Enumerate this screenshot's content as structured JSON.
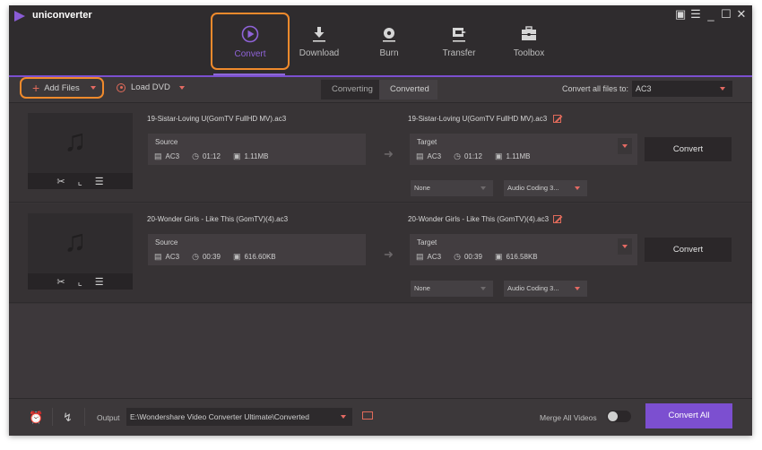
{
  "app": {
    "title": "uniconverter",
    "window_controls": [
      "feedback-icon",
      "menu-icon",
      "minimize-icon",
      "maximize-icon",
      "close-icon"
    ]
  },
  "nav": {
    "items": [
      {
        "label": "Convert",
        "icon": "convert-icon",
        "active": true
      },
      {
        "label": "Download",
        "icon": "download-icon",
        "active": false
      },
      {
        "label": "Burn",
        "icon": "burn-icon",
        "active": false
      },
      {
        "label": "Transfer",
        "icon": "transfer-icon",
        "active": false
      },
      {
        "label": "Toolbox",
        "icon": "toolbox-icon",
        "active": false
      }
    ]
  },
  "toolbar": {
    "add_files": "Add Files",
    "load_dvd": "Load DVD",
    "tabs": [
      "Converting",
      "Converted"
    ],
    "active_tab": "Converting",
    "convert_all_label": "Convert all files to:",
    "convert_all_value": "AC3"
  },
  "files": [
    {
      "source_name": "19-Sistar-Loving U(GomTV FullHD MV).ac3",
      "source_label": "Source",
      "source": {
        "format": "AC3",
        "duration": "01:12",
        "size": "1.11MB"
      },
      "target_name": "19-Sistar-Loving U(GomTV FullHD MV).ac3",
      "target_label": "Target",
      "target": {
        "format": "AC3",
        "duration": "01:12",
        "size": "1.11MB"
      },
      "subtitle": "None",
      "audio": "Audio Coding 3...",
      "convert_label": "Convert"
    },
    {
      "source_name": "20-Wonder Girls - Like This (GomTV)(4).ac3",
      "source_label": "Source",
      "source": {
        "format": "AC3",
        "duration": "00:39",
        "size": "616.60KB"
      },
      "target_name": "20-Wonder Girls - Like This (GomTV)(4).ac3",
      "target_label": "Target",
      "target": {
        "format": "AC3",
        "duration": "00:39",
        "size": "616.58KB"
      },
      "subtitle": "None",
      "audio": "Audio Coding 3...",
      "convert_label": "Convert"
    }
  ],
  "footer": {
    "output_label": "Output",
    "output_path": "E:\\Wondershare Video Converter Ultimate\\Converted",
    "merge_label": "Merge All Videos",
    "merge_enabled": false,
    "convert_all": "Convert All"
  },
  "colors": {
    "accent_purple": "#7c4fd0",
    "highlight_orange": "#f08a2c",
    "icon_red": "#e06a5a"
  }
}
